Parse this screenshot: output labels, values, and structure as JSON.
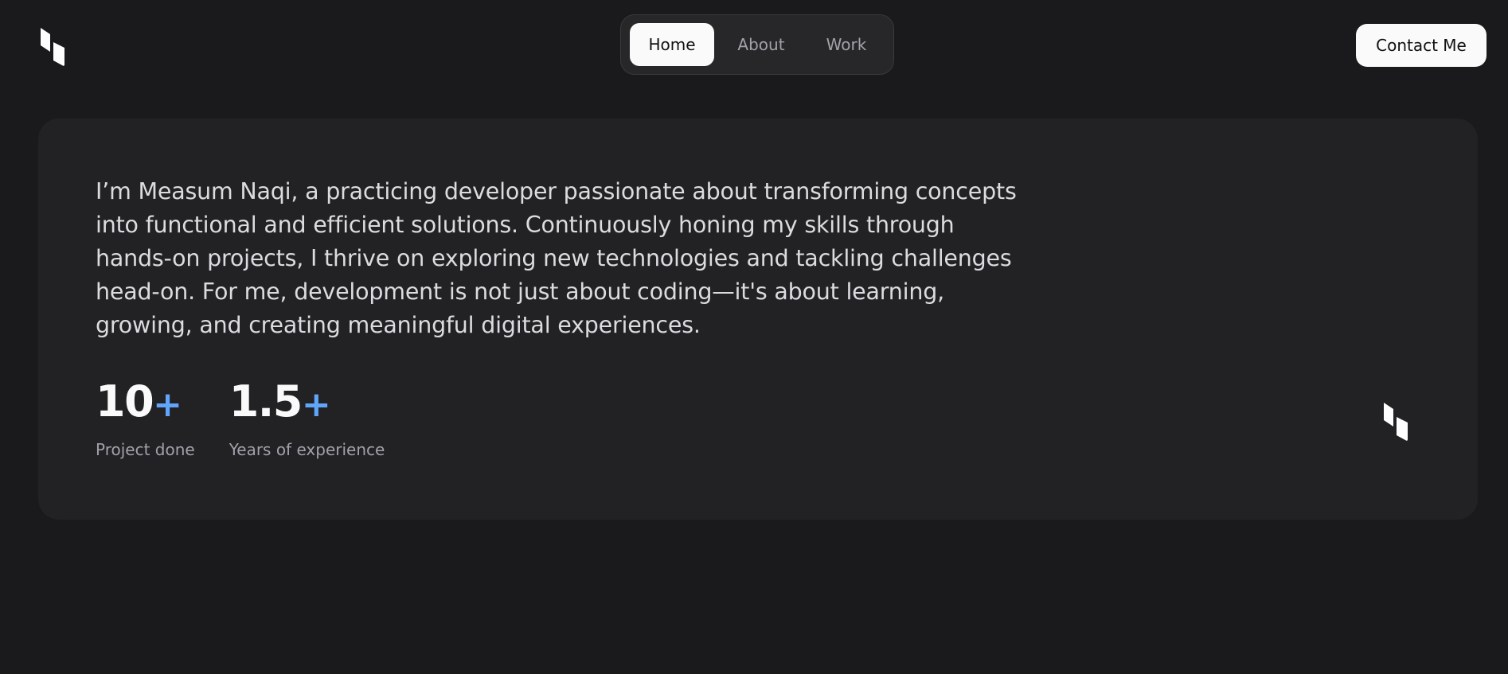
{
  "header": {
    "logo_icon": "kite-logo-icon",
    "nav": [
      {
        "label": "Home",
        "active": true
      },
      {
        "label": "About",
        "active": false
      },
      {
        "label": "Work",
        "active": false
      }
    ],
    "contact_label": "Contact Me"
  },
  "main": {
    "bio": "I’m Measum Naqi, a practicing developer passionate about transforming concepts into functional and efficient solutions. Continuously honing my skills through hands-on projects, I thrive on exploring new technologies and tackling challenges head-on. For me, development is not just about coding—it's about learning, growing, and creating meaningful digital experiences.",
    "stats": [
      {
        "value": "10",
        "suffix": "+",
        "label": "Project done"
      },
      {
        "value": "1.5",
        "suffix": "+",
        "label": "Years of experience"
      }
    ],
    "card_logo_icon": "kite-logo-icon"
  },
  "colors": {
    "background": "#1a1a1c",
    "card": "#222224",
    "accent": "#60a5fa",
    "button": "#fafafa"
  }
}
